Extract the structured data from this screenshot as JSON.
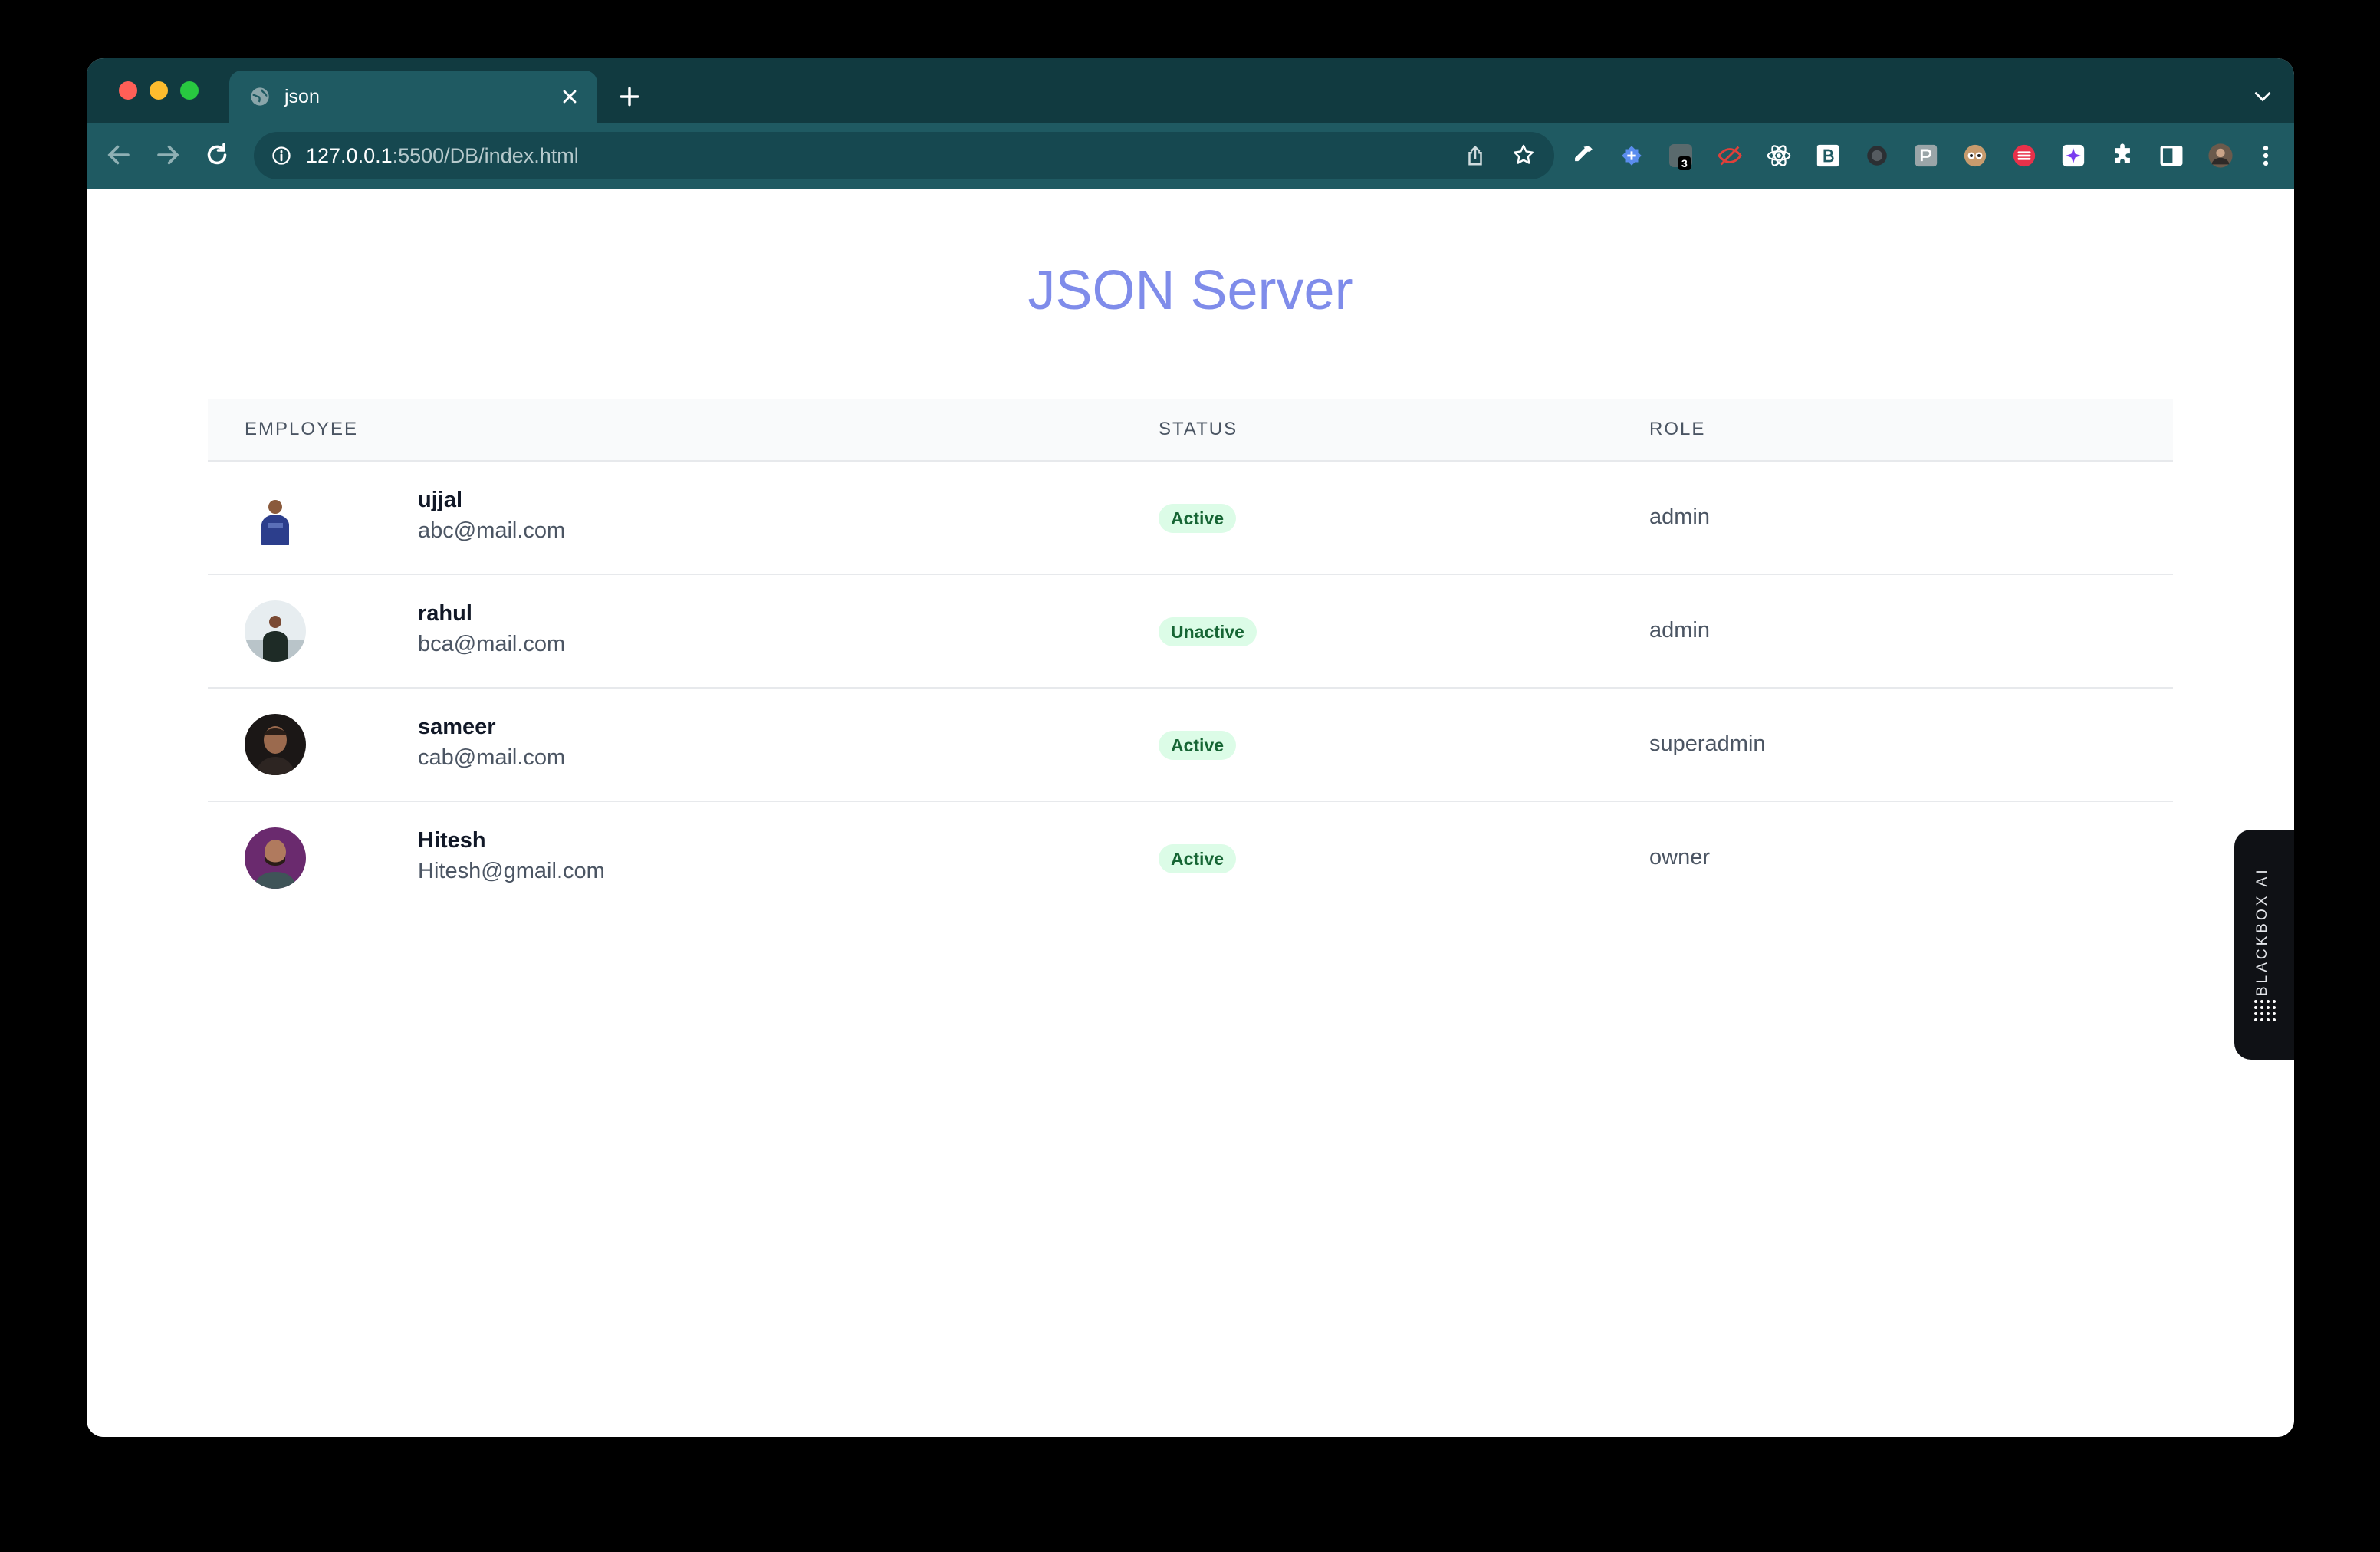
{
  "browser": {
    "tab_title": "json",
    "url_host": "127.0.0.1",
    "url_path": ":5500/DB/index.html",
    "extension_badge": "3"
  },
  "page": {
    "heading": "JSON Server",
    "table": {
      "headers": {
        "employee": "EMPLOYEE",
        "status": "STATUS",
        "role": "ROLE"
      },
      "rows": [
        {
          "name": "ujjal",
          "email": "abc@mail.com",
          "status": "Active",
          "role": "admin"
        },
        {
          "name": "rahul",
          "email": "bca@mail.com",
          "status": "Unactive",
          "role": "admin"
        },
        {
          "name": "sameer",
          "email": "cab@mail.com",
          "status": "Active",
          "role": "superadmin"
        },
        {
          "name": "Hitesh",
          "email": "Hitesh@gmail.com",
          "status": "Active",
          "role": "owner"
        }
      ]
    }
  },
  "widget": {
    "label": "BLACKBOX AI"
  },
  "colors": {
    "heading": "#7f8cea",
    "status_bg": "#dcfce7",
    "status_text": "#166534",
    "tabstrip": "#113a40",
    "toolbar": "#1f5a62"
  },
  "icons": [
    "globe-icon",
    "close-icon",
    "plus-icon",
    "chevron-down-icon",
    "back-arrow-icon",
    "forward-arrow-icon",
    "reload-icon",
    "info-icon",
    "share-icon",
    "star-icon",
    "puzzle-icon",
    "sidebar-icon",
    "more-vert-icon"
  ]
}
